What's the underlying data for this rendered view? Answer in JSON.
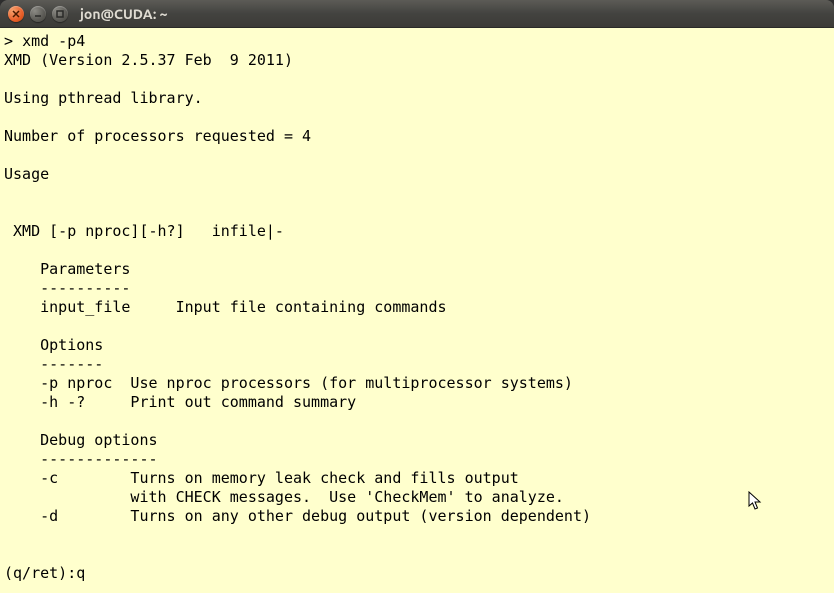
{
  "titlebar": {
    "title": "jon@CUDA: ~"
  },
  "terminal": {
    "prompt": "> ",
    "command": "xmd -p4",
    "lines": {
      "version": "XMD (Version 2.5.37 Feb  9 2011)",
      "blank": "",
      "pthread": "Using pthread library.",
      "nproc": "Number of processors requested = 4",
      "usage": "Usage",
      "synopsis": " XMD [-p nproc][-h?]   infile|-",
      "params_hdr": "    Parameters",
      "params_dash": "    ----------",
      "params_input": "    input_file     Input file containing commands",
      "opts_hdr": "    Options",
      "opts_dash": "    -------",
      "opts_p": "    -p nproc  Use nproc processors (for multiprocessor systems)",
      "opts_h": "    -h -?     Print out command summary",
      "dbg_hdr": "    Debug options",
      "dbg_dash": "    -------------",
      "dbg_c1": "    -c        Turns on memory leak check and fills output",
      "dbg_c2": "              with CHECK messages.  Use 'CheckMem' to analyze.",
      "dbg_d": "    -d        Turns on any other debug output (version dependent)",
      "quit_prompt": "(q/ret):",
      "quit_input": "q"
    }
  }
}
